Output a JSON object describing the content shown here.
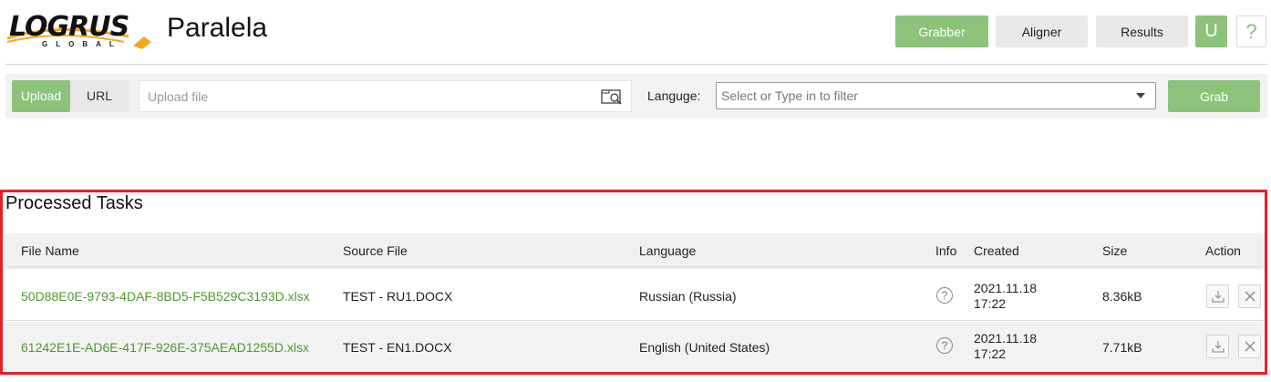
{
  "header": {
    "logo_text": "LOGRUS",
    "logo_sub": "GLOBAL",
    "app_title": "Paralela",
    "nav": [
      {
        "label": "Grabber",
        "active": true
      },
      {
        "label": "Aligner",
        "active": false
      },
      {
        "label": "Results",
        "active": false
      }
    ],
    "user_initial": "U",
    "help_label": "?"
  },
  "toolbar": {
    "tab_upload": "Upload",
    "tab_url": "URL",
    "upload_placeholder": "Upload file",
    "language_label": "Languge:",
    "language_placeholder": "Select or Type in to filter",
    "grab_label": "Grab"
  },
  "tasks": {
    "title": "Processed Tasks",
    "columns": [
      "File Name",
      "Source File",
      "Language",
      "Info",
      "Created",
      "Size",
      "Action"
    ],
    "rows": [
      {
        "file_name": "50D88E0E-9793-4DAF-8BD5-F5B529C3193D.xlsx",
        "source_file": "TEST - RU1.DOCX",
        "language": "Russian (Russia)",
        "info": "?",
        "created_date": "2021.11.18",
        "created_time": "17:22",
        "size": "8.36kB"
      },
      {
        "file_name": "61242E1E-AD6E-417F-926E-375AEAD1255D.xlsx",
        "source_file": "TEST - EN1.DOCX",
        "language": "English (United States)",
        "info": "?",
        "created_date": "2021.11.18",
        "created_time": "17:22",
        "size": "7.71kB"
      }
    ]
  },
  "colors": {
    "accent": "#8dc27a",
    "link": "#4a9b2a",
    "highlight_frame": "#e3202a"
  }
}
